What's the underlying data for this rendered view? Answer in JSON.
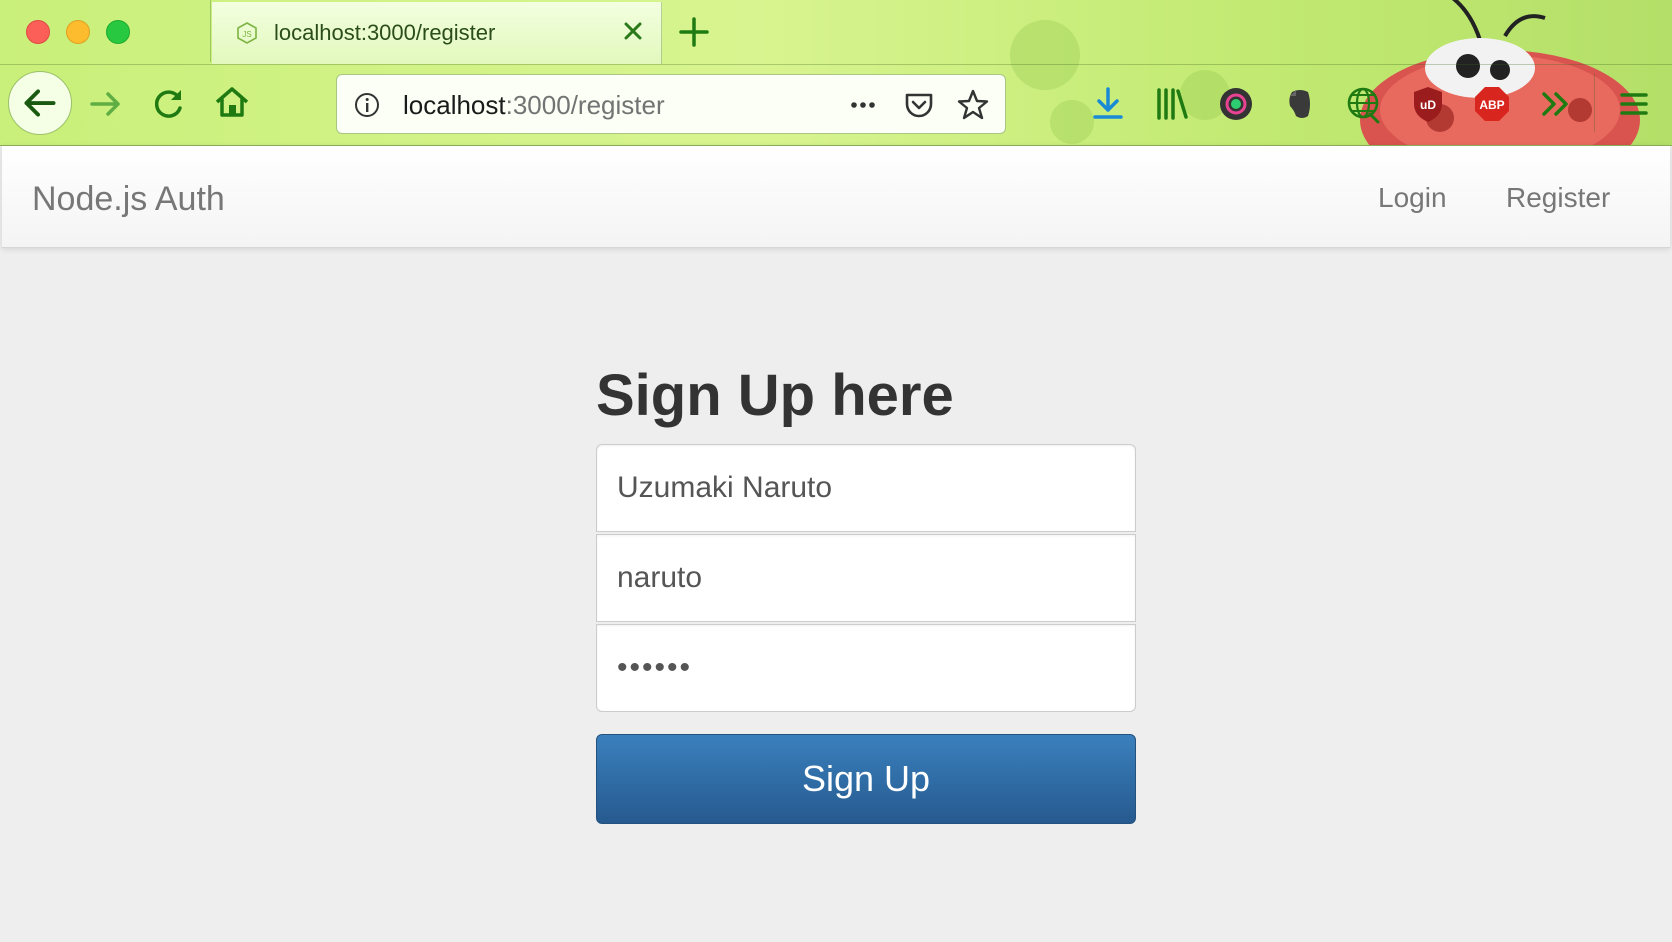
{
  "browser": {
    "tab": {
      "title": "localhost:3000/register",
      "favicon": "nodejs-icon"
    },
    "url": {
      "host": "localhost",
      "rest": ":3000/register"
    },
    "toolbar_icons": [
      "back-icon",
      "forward-icon",
      "reload-icon",
      "home-icon",
      "info-icon",
      "more-icon",
      "pocket-icon",
      "bookmark-star-icon",
      "download-icon",
      "library-icon",
      "color-picker-icon",
      "evernote-icon",
      "globe-icon",
      "ublock-icon",
      "adblock-plus-icon",
      "overflow-chevron-icon",
      "menu-icon"
    ],
    "adblock_label": "ABP",
    "ublock_label": "uD",
    "accent_color": "#2a8a1a"
  },
  "site": {
    "brand": "Node.js Auth",
    "nav": {
      "login": "Login",
      "register": "Register"
    }
  },
  "form": {
    "heading": "Sign Up here",
    "name_value": "Uzumaki Naruto",
    "username_value": "naruto",
    "password_value": "••••••",
    "submit_label": "Sign Up",
    "button_color": "#2f6fa8"
  }
}
